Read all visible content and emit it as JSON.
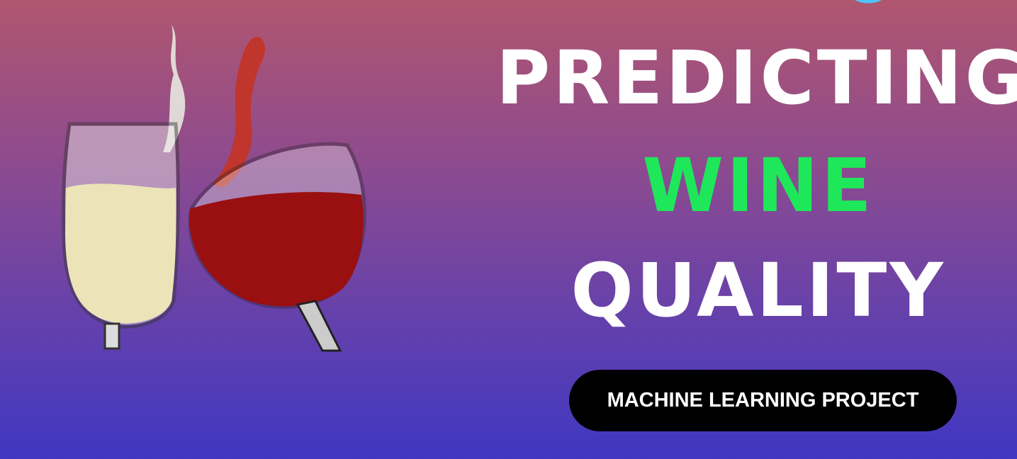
{
  "headline": {
    "line1": "PREDICTING",
    "line2": "WINE",
    "line3": "QUALITY"
  },
  "badge": "MACHINE LEARNING PROJECT",
  "colors": {
    "accent": "#1ee85a",
    "badge_bg": "#000000",
    "gradient_top": "#b0566f",
    "gradient_bottom": "#3f37c2"
  }
}
